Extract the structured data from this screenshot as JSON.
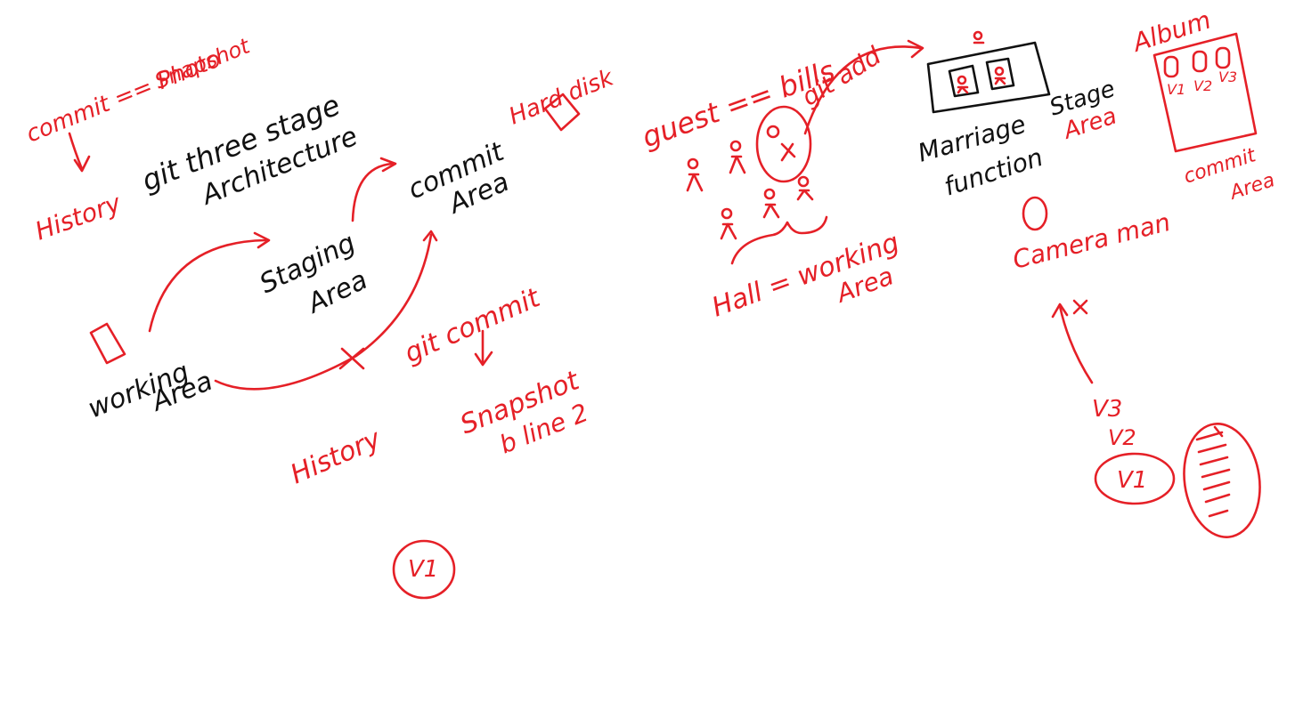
{
  "colors": {
    "red_ink": "#e52027",
    "black_ink": "#111111",
    "background": "#ffffff"
  },
  "left_diagram": {
    "commit_photo_line1": "commit == Photo",
    "commit_photo_line2": "Snapshot",
    "history_top": "History",
    "title_line1": "git three stage",
    "title_line2": "Architecture",
    "hard_disk": "Hard disk",
    "commit_area_line1": "commit",
    "commit_area_line2": "Area",
    "staging_area_line1": "Staging",
    "staging_area_line2": "Area",
    "working_area_line1": "working",
    "working_area_line2": "Area",
    "git_commit": "git commit",
    "snapshot_line1": "Snapshot",
    "snapshot_line2": "b line 2",
    "history_bottom": "History",
    "version_circle": "V1"
  },
  "right_diagram": {
    "guest_bills": "guest == bills",
    "git_add": "git add",
    "marriage_line1": "Marriage",
    "marriage_line2": "function",
    "stage_area_line1": "Stage",
    "stage_area_line2": "Area",
    "album": "Album",
    "album_versions": [
      "V1",
      "V2",
      "V3"
    ],
    "commit_area_line1": "commit",
    "commit_area_line2": "Area",
    "camera_man": "Camera man",
    "hall_line1": "Hall = working",
    "hall_line2": "Area",
    "versions_stack": [
      "V3",
      "V2",
      "V1"
    ]
  }
}
